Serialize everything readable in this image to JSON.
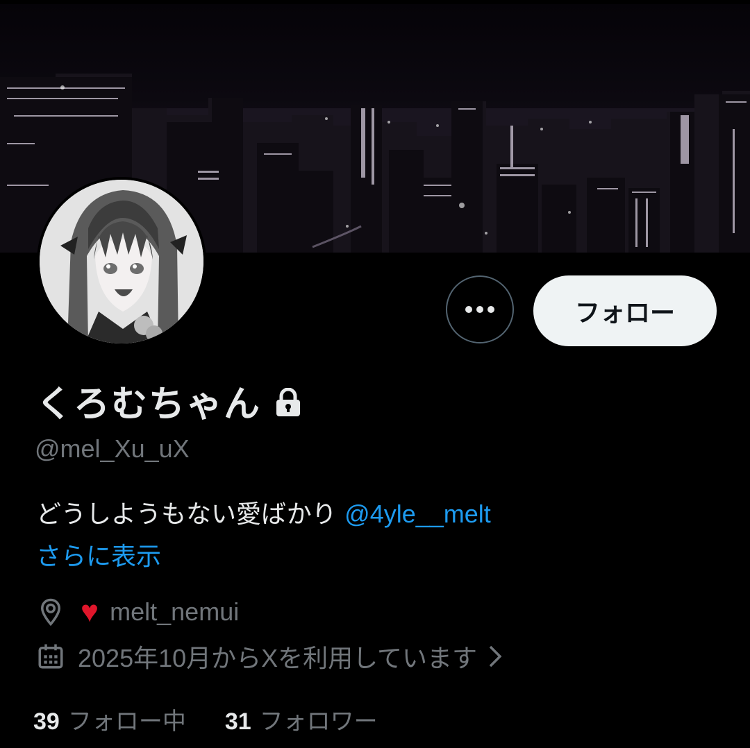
{
  "profile": {
    "display_name": "くろむちゃん",
    "handle": "@mel_Xu_uX",
    "bio_text": "どうしようもない愛ばかり ",
    "bio_mention": "@4yle__melt",
    "show_more": "さらに表示",
    "location": "melt_nemui",
    "joined": "2025年10月からXを利用しています",
    "protected_icon": "lock-icon"
  },
  "actions": {
    "follow_label": "フォロー",
    "more_icon": "more-dots-icon"
  },
  "stats": {
    "following_count": "39",
    "following_label": "フォロー中",
    "followers_count": "31",
    "followers_label": "フォロワー"
  },
  "colors": {
    "accent": "#1d9bf0",
    "heart": "#e0162b",
    "muted": "#71767b",
    "follow_bg": "#eff3f4"
  }
}
